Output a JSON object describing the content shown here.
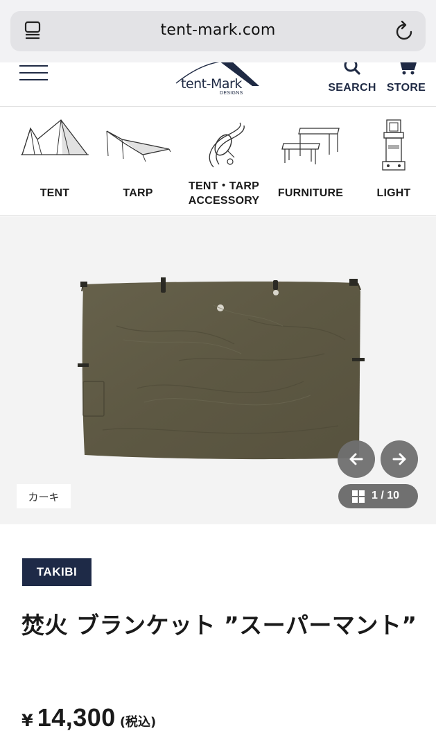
{
  "browser": {
    "url": "tent-mark.com",
    "reader_icon": "reader-mode-icon",
    "reload_icon": "reload-icon"
  },
  "header": {
    "logo_text": "tent-Mark",
    "logo_sub": "DESIGNS",
    "search_label": "SEARCH",
    "store_label": "STORE",
    "brand_color": "#1f2a44"
  },
  "categories": [
    {
      "label": "TENT",
      "icon": "tent-icon"
    },
    {
      "label": "TARP",
      "icon": "tarp-icon"
    },
    {
      "label": "TENT・TARP ACCESSORY",
      "line1": "TENT・TARP",
      "line2": "ACCESSORY",
      "icon": "carabiner-icon"
    },
    {
      "label": "FURNITURE",
      "icon": "table-icon"
    },
    {
      "label": "LIGHT",
      "icon": "lantern-icon"
    }
  ],
  "gallery": {
    "color_label": "カーキ",
    "counter": "1 / 10",
    "current": 1,
    "total": 10,
    "product_color": "#5f5a45"
  },
  "product": {
    "brand": "TAKIBI",
    "title": "焚火 ブランケット ”スーパーマント”",
    "currency": "¥",
    "price": "14,300",
    "tax_note": "(税込)",
    "badge_color": "#1e2a47"
  }
}
